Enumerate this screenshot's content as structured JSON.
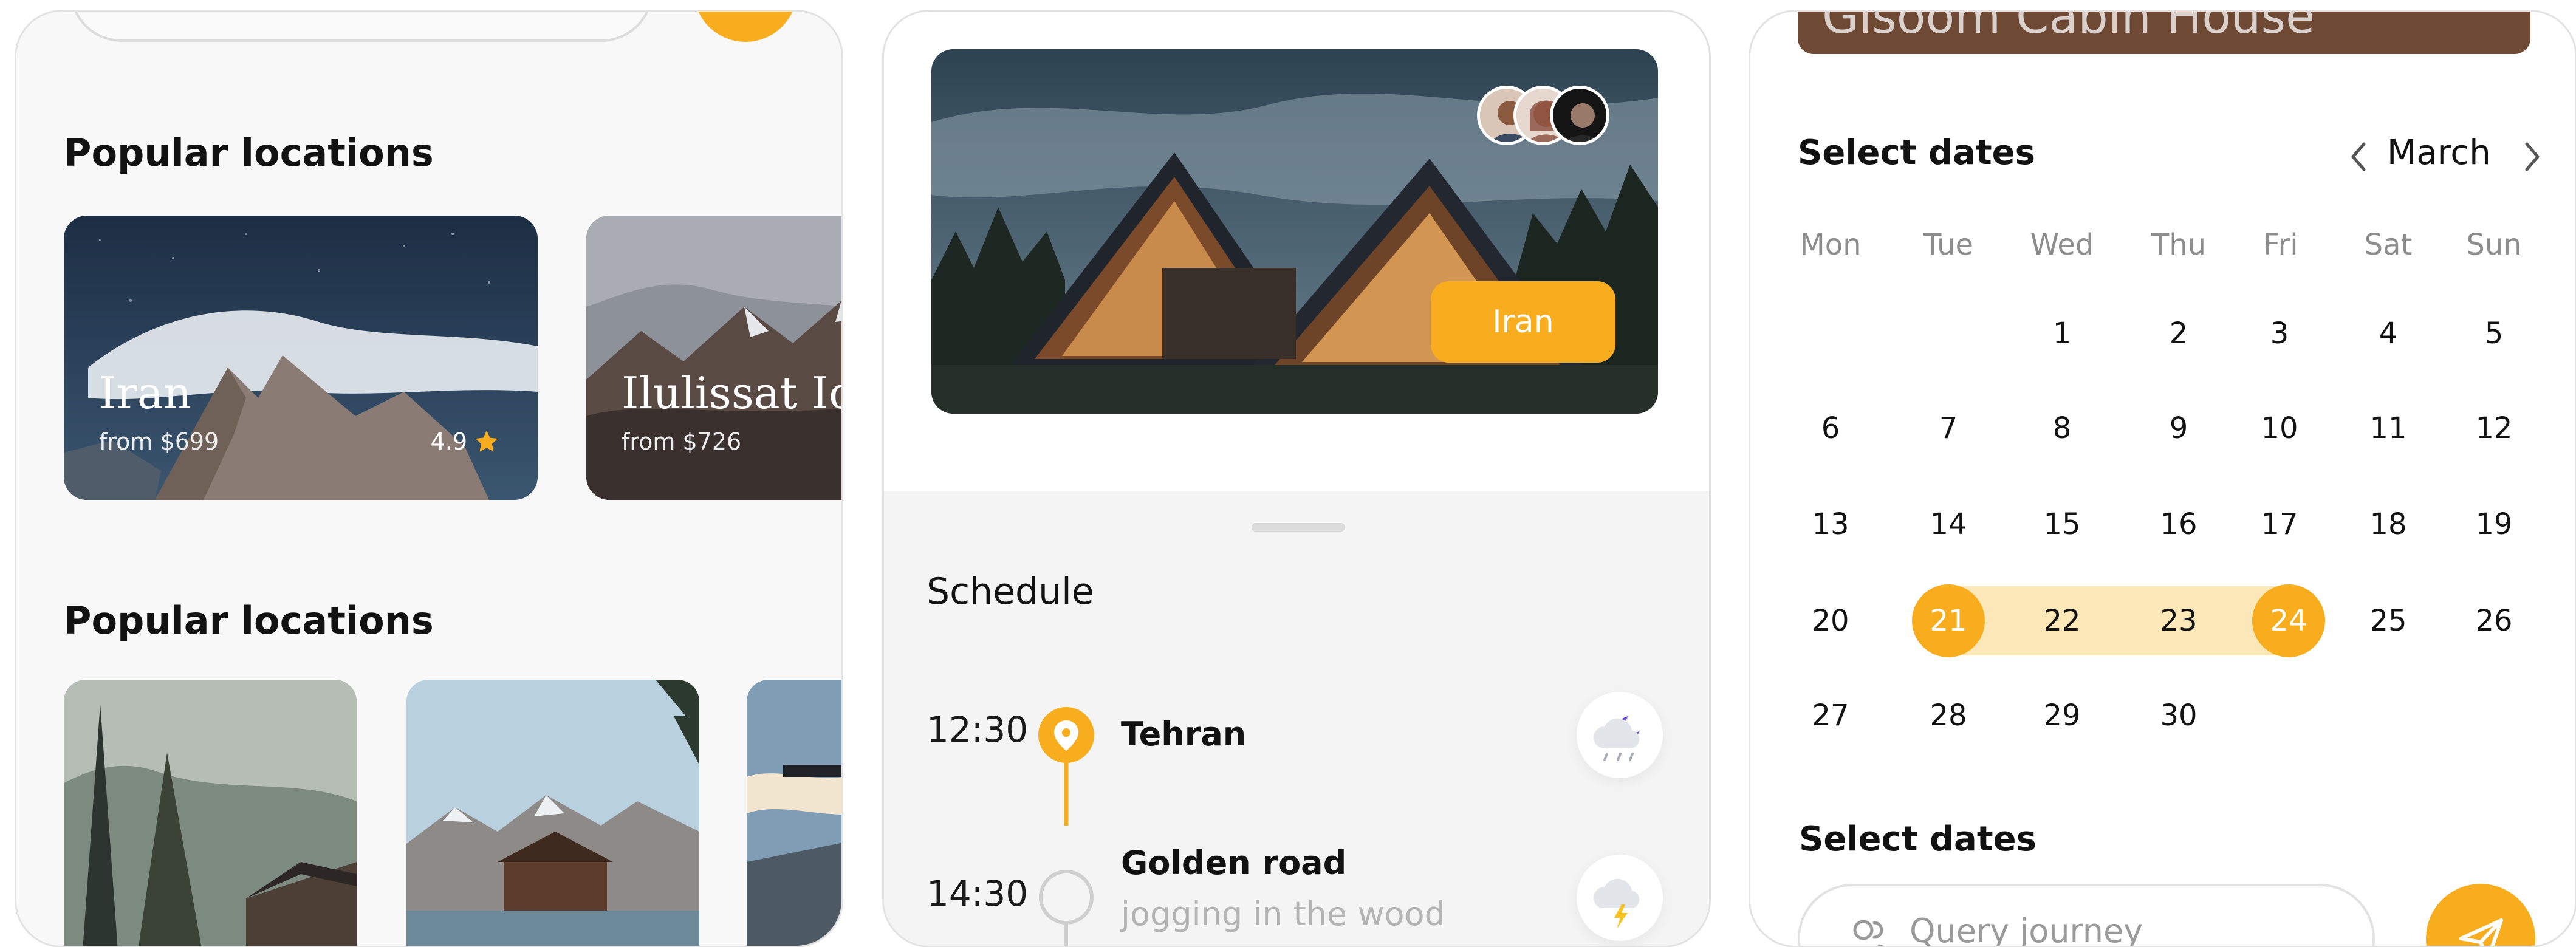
{
  "left_screen": {
    "section_1_title": "Popular locations",
    "section_2_title": "Popular locations",
    "cards": [
      {
        "name": "Iran",
        "price": "from $699",
        "rating": "4.9"
      },
      {
        "name": "Ilulissat Ic",
        "price": "from $726"
      }
    ]
  },
  "middle_screen": {
    "hero_button": "Iran",
    "schedule_title": "Schedule",
    "items": [
      {
        "time": "12:30",
        "place": "Tehran",
        "weather_icon": "cloud-moon-rain-icon"
      },
      {
        "time": "14:30",
        "place": "Golden road",
        "note": "jogging in the wood",
        "weather_icon": "cloud-lightning-icon"
      }
    ]
  },
  "right_screen": {
    "partial_title": "Gisoom Cabin House",
    "select_dates_title": "Select dates",
    "month": "March",
    "weekdays": [
      "Mon",
      "Tue",
      "Wed",
      "Thu",
      "Fri",
      "Sat",
      "Sun"
    ],
    "days": [
      "1",
      "2",
      "3",
      "4",
      "5",
      "6",
      "7",
      "8",
      "9",
      "10",
      "11",
      "12",
      "13",
      "14",
      "15",
      "16",
      "17",
      "18",
      "19",
      "20",
      "21",
      "22",
      "23",
      "24",
      "25",
      "26",
      "27",
      "28",
      "29",
      "30"
    ],
    "selected_range": [
      "21",
      "24"
    ],
    "select_dates_title_2": "Select dates",
    "query_placeholder": "Query journey"
  },
  "colors": {
    "accent": "#f7ad1e",
    "range_fill": "#fbe7b7",
    "panel_border": "#e2e2e2",
    "muted_text": "#8d8d8d"
  }
}
